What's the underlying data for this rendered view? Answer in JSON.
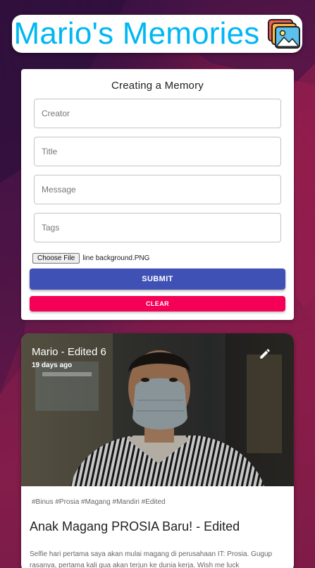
{
  "app": {
    "title": "Mario's Memories",
    "logo_icon": "photos-stack-icon",
    "accent_color": "#00b7f1"
  },
  "form": {
    "heading": "Creating a Memory",
    "creator_placeholder": "Creator",
    "title_placeholder": "Title",
    "message_placeholder": "Message",
    "tags_placeholder": "Tags",
    "file_button_label": "Choose File",
    "file_name": "line background.PNG",
    "submit_label": "SUBMIT",
    "clear_label": "CLEAR",
    "submit_color": "#3f51b5",
    "clear_color": "#f50057"
  },
  "posts": [
    {
      "creator": "Mario - Edited 6",
      "time": "19 days ago",
      "edit_icon": "pencil-icon",
      "tags": "#Binus #Prosia #Magang #Mandiri #Edited",
      "title": "Anak Magang PROSIA Baru! - Edited",
      "message": "Selfie hari pertama saya akan mulai magang di perusahaan IT: Prosia. Gugup rasanya, pertama kali gua akan terjun ke dunia kerja. Wish me luck"
    }
  ]
}
